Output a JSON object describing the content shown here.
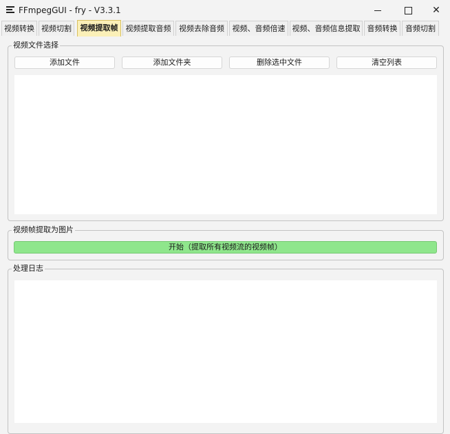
{
  "window": {
    "title": "FFmpegGUI - fry - V3.3.1",
    "controls": {
      "minimize": "—",
      "maximize": "☐",
      "close": "✕"
    }
  },
  "tabs": [
    {
      "label": "视频转换",
      "active": false
    },
    {
      "label": "视频切割",
      "active": false
    },
    {
      "label": "视频提取帧",
      "active": true
    },
    {
      "label": "视频提取音频",
      "active": false
    },
    {
      "label": "视频去除音频",
      "active": false
    },
    {
      "label": "视频、音频倍速",
      "active": false
    },
    {
      "label": "视频、音频信息提取",
      "active": false
    },
    {
      "label": "音频转换",
      "active": false
    },
    {
      "label": "音频切割",
      "active": false
    }
  ],
  "file_select": {
    "title": "视频文件选择",
    "buttons": {
      "add_file": "添加文件",
      "add_folder": "添加文件夹",
      "delete_selected": "删除选中文件",
      "clear_list": "清空列表"
    }
  },
  "extract": {
    "title": "视频帧提取为图片",
    "start_button": "开始（提取所有视频流的视频帧）"
  },
  "log": {
    "title": "处理日志"
  },
  "colors": {
    "active_tab": "#fbf0b8",
    "start_button": "#8fe68c",
    "background": "#f3f3f3"
  }
}
